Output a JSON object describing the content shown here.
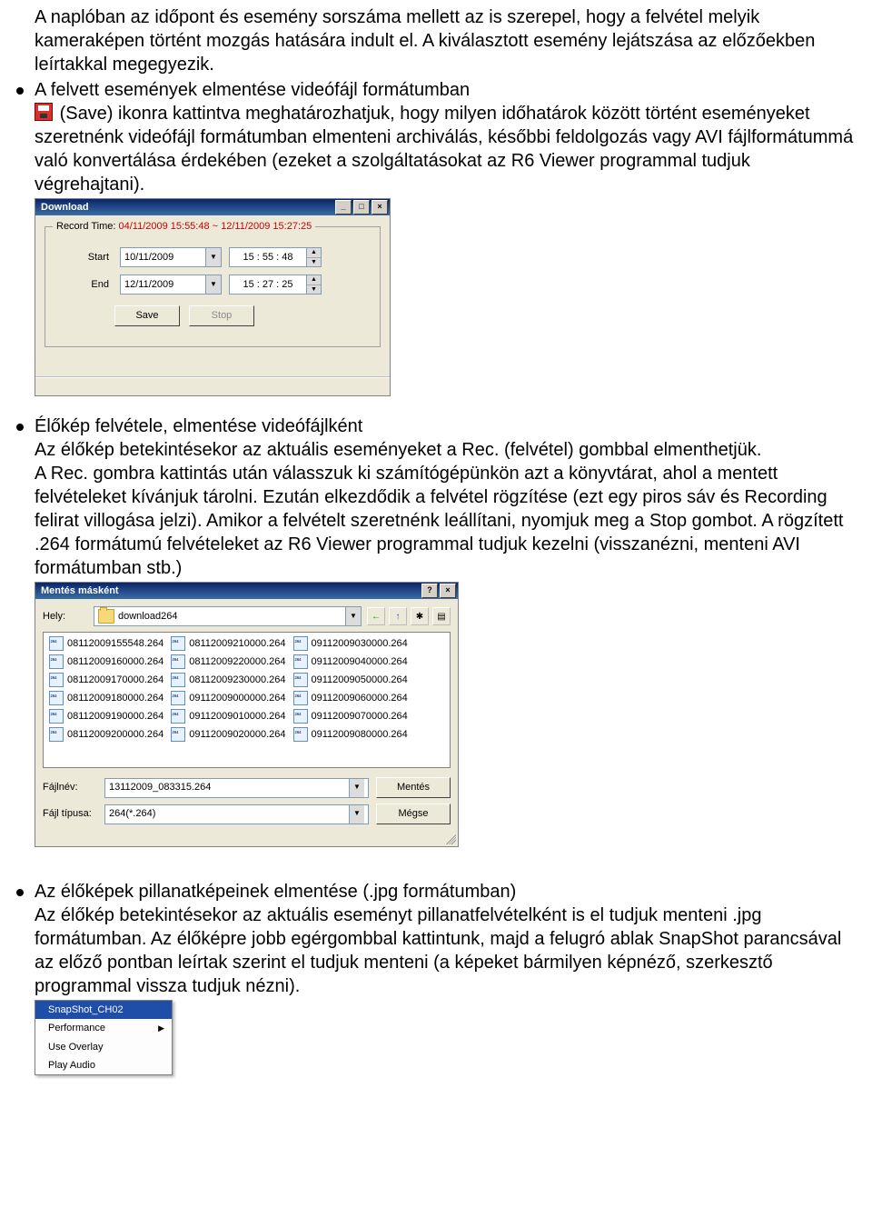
{
  "para1": "A naplóban az időpont és esemény sorszáma mellett az is szerepel, hogy a felvétel melyik kameraképen történt mozgás hatására indult el. A kiválasztott esemény lejátszása az előzőekben leírtakkal megegyezik.",
  "bullet2_lead": "A felvett események elmentése videófájl formátumban",
  "bullet2_body": " (Save) ikonra kattintva meghatározhatjuk, hogy milyen időhatárok között történt eseményeket szeretnénk videófájl formátumban elmenteni archiválás, későbbi feldolgozás vagy AVI fájlformátummá való konvertálása érdekében (ezeket a szolgáltatásokat az R6 Viewer programmal tudjuk végrehajtani).",
  "download": {
    "title": "Download",
    "min": "_",
    "max": "□",
    "close": "×",
    "legend_lbl": "Record Time:",
    "legend_val": " 04/11/2009 15:55:48 ~ 12/11/2009 15:27:25",
    "start_lbl": "Start",
    "start_date": "10/11/2009",
    "start_time": "15 : 55 : 48",
    "end_lbl": "End",
    "end_date": "12/11/2009",
    "end_time": "15 : 27 : 25",
    "save_btn": "Save",
    "stop_btn": "Stop"
  },
  "bullet3_title": "Élőkép felvétele, elmentése videófájlként",
  "bullet3_body": "Az élőkép betekintésekor az aktuális eseményeket a Rec. (felvétel) gombbal elmenthetjük.\nA Rec. gombra kattintás  után válasszuk ki számítógépünkön azt a könyvtárat, ahol a mentett felvételeket kívánjuk tárolni. Ezután elkezdődik a felvétel rögzítése (ezt egy piros sáv és Recording felirat villogása jelzi). Amikor a felvételt szeretnénk leállítani, nyomjuk meg a Stop gombot. A rögzített .264 formátumú felvételeket az R6 Viewer programmal tudjuk kezelni (visszanézni, menteni AVI formátumban stb.)",
  "saveas": {
    "title": "Mentés másként",
    "help": "?",
    "close": "×",
    "location_lbl": "Hely:",
    "folder": "download264",
    "back": "←",
    "up": "↑",
    "newf": "✱",
    "view": "▤",
    "files_col1": [
      "08112009155548.264",
      "08112009160000.264",
      "08112009170000.264",
      "08112009180000.264",
      "08112009190000.264",
      "08112009200000.264"
    ],
    "files_col2": [
      "08112009210000.264",
      "08112009220000.264",
      "08112009230000.264",
      "09112009000000.264",
      "09112009010000.264",
      "09112009020000.264"
    ],
    "files_col3": [
      "09112009030000.264",
      "09112009040000.264",
      "09112009050000.264",
      "09112009060000.264",
      "09112009070000.264",
      "09112009080000.264"
    ],
    "filename_lbl": "Fájlnév:",
    "filename_val": "13112009_083315.264",
    "filetype_lbl": "Fájl típusa:",
    "filetype_val": "264(*.264)",
    "save_btn": "Mentés",
    "cancel_btn": "Mégse"
  },
  "bullet4_title": "Az élőképek pillanatképeinek elmentése (.jpg formátumban)",
  "bullet4_body": "Az élőkép betekintésekor az aktuális eseményt pillanatfelvételként is el tudjuk menteni .jpg formátumban. Az élőképre jobb egérgombbal kattintunk, majd a felugró ablak SnapShot parancsával az előző pontban leírtak szerint el tudjuk menteni (a képeket bármilyen képnéző, szerkesztő programmal vissza tudjuk nézni).",
  "ctx": {
    "i1": "SnapShot_CH02",
    "i2": "Performance",
    "i3": "Use Overlay",
    "i4": "Play Audio"
  }
}
